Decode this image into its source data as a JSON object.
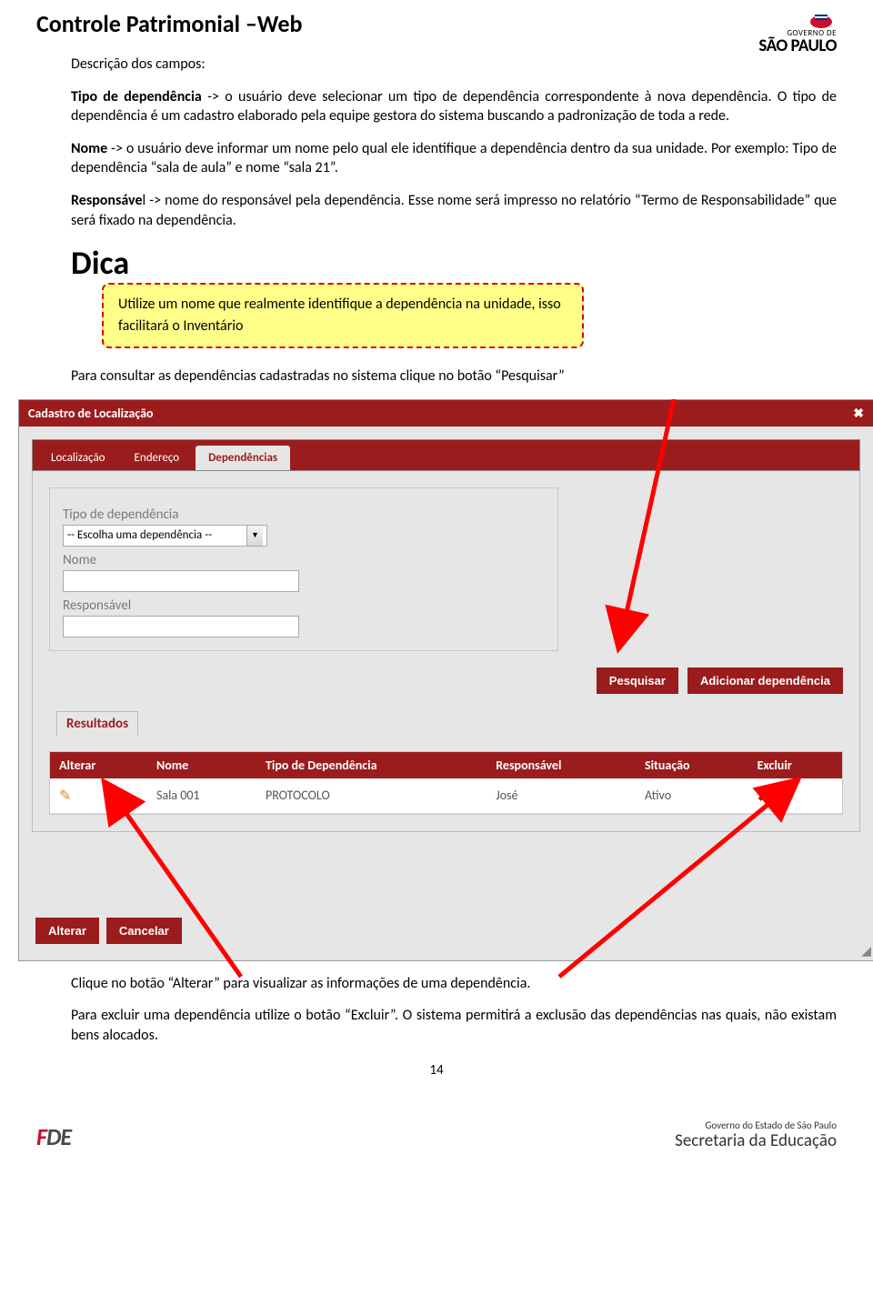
{
  "header": {
    "page_title": "Controle Patrimonial –Web",
    "gov_line1": "GOVERNO DE",
    "gov_line2": "SÃO PAULO"
  },
  "text": {
    "descricao": "Descrição dos campos:",
    "tipo_label": "Tipo de dependência",
    "tipo_desc": " -> o usuário deve selecionar um tipo de dependência correspondente à nova dependência. O tipo de dependência é um cadastro elaborado pela equipe gestora do sistema buscando a padronização de toda a rede.",
    "nome_label": "Nome",
    "nome_desc": " -> o usuário deve informar um nome pelo qual ele identifique a dependência dentro da sua unidade. Por exemplo: Tipo de dependência “sala de aula” e nome “sala 21”.",
    "resp_label": "Responsáve",
    "resp_desc": "l -> nome do responsável pela dependência. Esse nome será impresso no relatório “Termo de Responsabilidade” que será fixado na dependência.",
    "dica_heading": "Dica",
    "tip": "Utilize um nome que realmente identifique a dependência na unidade, isso facilitará o Inventário",
    "para_consultar": "Para consultar as dependências cadastradas no sistema clique no botão “Pesquisar”",
    "clique_alterar": "Clique no botão “Alterar” para visualizar as informações de uma dependência.",
    "para_excluir": "Para excluir uma dependência utilize o botão “Excluir”. O sistema permitirá a exclusão das dependências nas quais, não existam bens alocados.",
    "page_num": "14"
  },
  "modal": {
    "title": "Cadastro de Localização",
    "tabs": {
      "t1": "Localização",
      "t2": "Endereço",
      "t3": "Dependências"
    },
    "form": {
      "tipo_label": "Tipo de dependência",
      "tipo_value": "-- Escolha uma dependência --",
      "nome_label": "Nome",
      "resp_label": "Responsável"
    },
    "btn_pesquisar": "Pesquisar",
    "btn_adicionar": "Adicionar dependência",
    "results_title": "Resultados",
    "cols": {
      "alterar": "Alterar",
      "nome": "Nome",
      "tipo": "Tipo de Dependência",
      "resp": "Responsável",
      "sit": "Situação",
      "excluir": "Excluir"
    },
    "row": {
      "nome": "Sala 001",
      "tipo": "PROTOCOLO",
      "resp": "José",
      "sit": "Ativo"
    },
    "btn_alterar": "Alterar",
    "btn_cancelar": "Cancelar"
  },
  "footer": {
    "fde": "FDE",
    "sec_l1": "Governo do Estado de São Paulo",
    "sec_l2": "Secretaria da Educação"
  }
}
